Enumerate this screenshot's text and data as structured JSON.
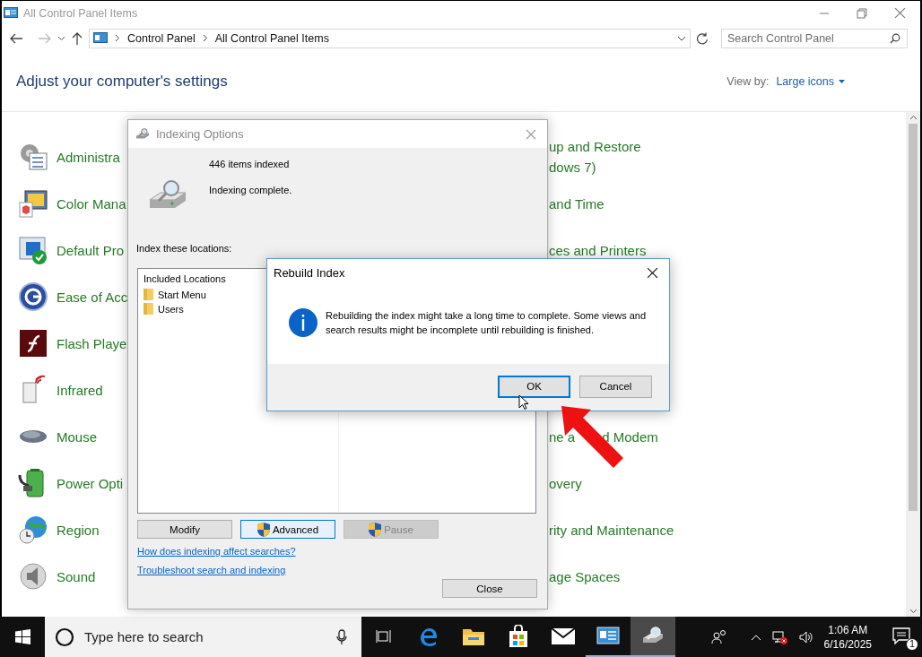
{
  "window": {
    "title": "All Control Panel Items"
  },
  "address_bar": {
    "breadcrumb": [
      "Control Panel",
      "All Control Panel Items"
    ]
  },
  "search": {
    "placeholder": "Search Control Panel"
  },
  "heading": "Adjust your computer's settings",
  "view_by": {
    "label": "View by:",
    "value": "Large icons"
  },
  "rows": [
    {
      "left": "Administra",
      "right": [
        [
          "up and Restore"
        ],
        [
          "dows 7)"
        ]
      ]
    },
    {
      "left": "Color Mana",
      "right": [
        [
          "and Time"
        ]
      ]
    },
    {
      "left": "Default Pro",
      "right": [
        [
          "ces and Printers"
        ]
      ]
    },
    {
      "left": "Ease of Acc"
    },
    {
      "left": "Flash Playe"
    },
    {
      "left": "Infrared"
    },
    {
      "left": "Mouse",
      "right": [
        [
          "ne a",
          "d Modem"
        ]
      ]
    },
    {
      "left": "Power Opti",
      "right": [
        [
          "overy"
        ]
      ]
    },
    {
      "left": "Region",
      "right": [
        [
          "rity and Maintenance"
        ]
      ]
    },
    {
      "left": "Sound",
      "right": [
        [
          "age Spaces"
        ]
      ]
    }
  ],
  "indexing_dialog": {
    "title": "Indexing Options",
    "count": "446 items indexed",
    "status": "Indexing complete.",
    "locations_label": "Index these locations:",
    "locations": {
      "header": "Included Locations",
      "items": [
        "Start Menu",
        "Users"
      ]
    },
    "buttons": [
      {
        "label": "Modify",
        "shield": false,
        "highlighted": false,
        "disabled": false
      },
      {
        "label": "Advanced",
        "shield": true,
        "highlighted": true,
        "disabled": false
      },
      {
        "label": "Pause",
        "shield": true,
        "highlighted": false,
        "disabled": true
      }
    ],
    "links": [
      "How does indexing affect searches?",
      "Troubleshoot search and indexing"
    ],
    "close_button": "Close"
  },
  "rebuild_dialog": {
    "title": "Rebuild Index",
    "message": "Rebuilding the index might take a long time to complete. Some views and search results might be incomplete until rebuilding is finished.",
    "buttons": [
      {
        "label": "OK",
        "focused": true
      },
      {
        "label": "Cancel",
        "focused": false
      }
    ]
  },
  "taskbar": {
    "search_placeholder": "Type here to search",
    "apps": [
      {
        "running": false,
        "selected": false
      },
      {
        "running": false,
        "selected": false
      },
      {
        "running": false,
        "selected": false
      },
      {
        "running": false,
        "selected": false
      },
      {
        "running": true,
        "selected": false
      },
      {
        "running": true,
        "selected": true
      }
    ],
    "time": "1:06 AM",
    "date": "6/16/2025",
    "notification_count": "1"
  }
}
